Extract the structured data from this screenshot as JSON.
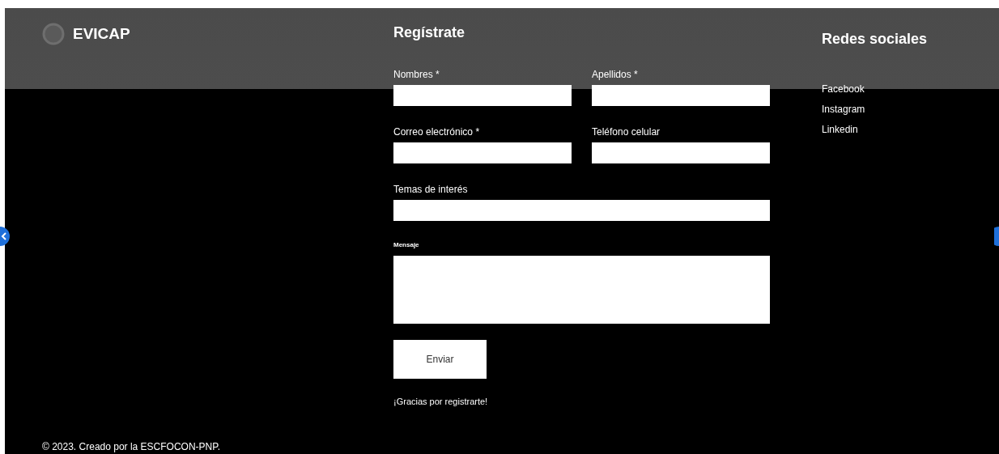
{
  "brand": {
    "name": "EVICAP"
  },
  "form": {
    "title": "Regístrate",
    "fields": [
      {
        "label": "Nombres *",
        "kind": "input",
        "wide": false
      },
      {
        "label": "Apellidos *",
        "kind": "input",
        "wide": false
      },
      {
        "label": "Correo electrónico *",
        "kind": "input",
        "wide": false
      },
      {
        "label": "Teléfono celular",
        "kind": "input",
        "wide": false
      },
      {
        "label": "Temas de interés",
        "kind": "input",
        "wide": true
      },
      {
        "label": "Mensaje",
        "kind": "textarea",
        "wide": true
      }
    ],
    "submit": "Enviar",
    "thanks": "¡Gracias por registrarte!"
  },
  "social": {
    "title": "Redes sociales",
    "links": [
      "Facebook",
      "Instagram",
      "Linkedin"
    ]
  },
  "footer": "© 2023. Creado por la ESCFOCON-PNP."
}
